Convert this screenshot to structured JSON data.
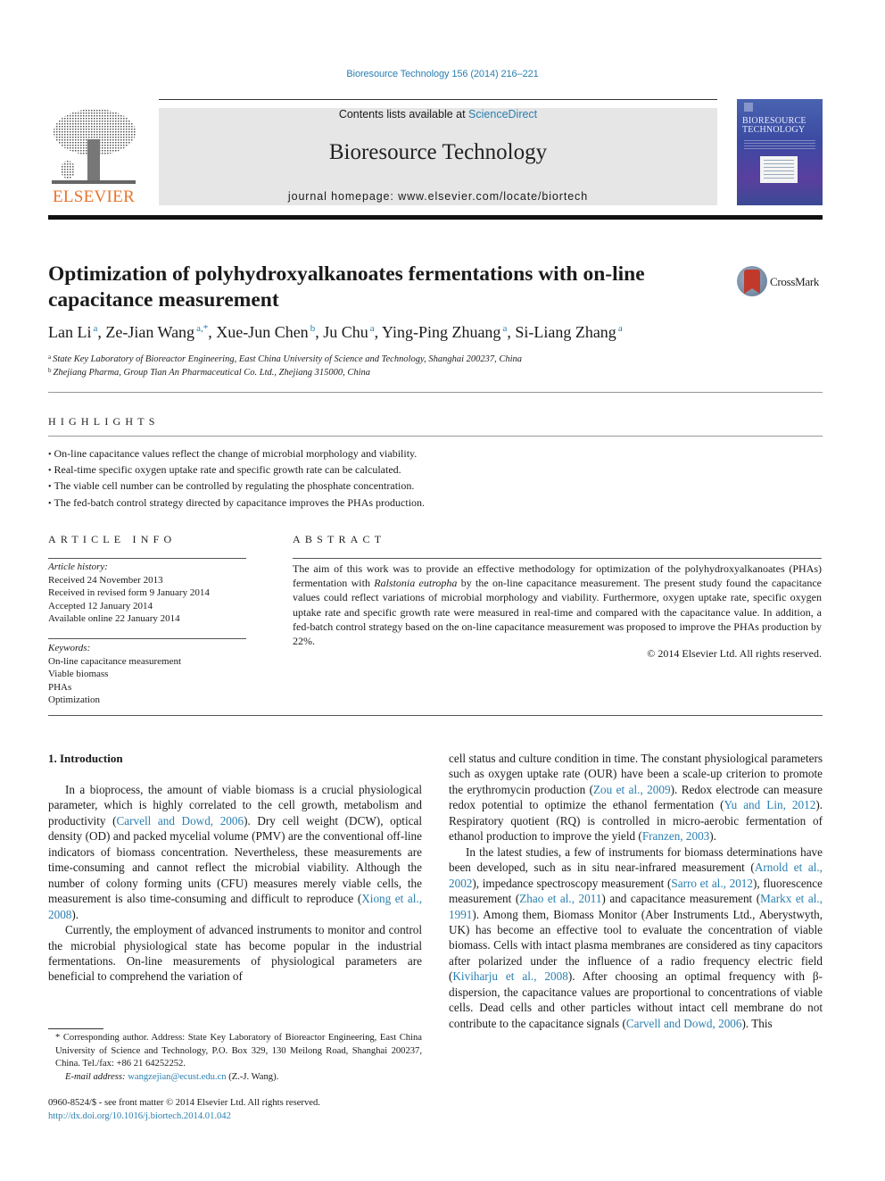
{
  "header": {
    "citation": "Bioresource Technology 156 (2014) 216–221",
    "contents_prefix": "Contents lists available at ",
    "contents_link": "ScienceDirect",
    "journal_name": "Bioresource Technology",
    "homepage": "journal homepage: www.elsevier.com/locate/biortech",
    "publisher_logo_text": "ELSEVIER",
    "cover_title_line1": "BIORESOURCE",
    "cover_title_line2": "TECHNOLOGY",
    "crossmark_label": "CrossMark"
  },
  "article": {
    "title": "Optimization of polyhydroxyalkanoates fermentations with on-line capacitance measurement",
    "authors": [
      {
        "name": "Lan Li",
        "aff": "a"
      },
      {
        "name": "Ze-Jian Wang",
        "aff": "a,*"
      },
      {
        "name": "Xue-Jun Chen",
        "aff": "b"
      },
      {
        "name": "Ju Chu",
        "aff": "a"
      },
      {
        "name": "Ying-Ping Zhuang",
        "aff": "a"
      },
      {
        "name": "Si-Liang Zhang",
        "aff": "a"
      }
    ],
    "affiliations": [
      {
        "key": "a",
        "text": "State Key Laboratory of Bioreactor Engineering, East China University of Science and Technology, Shanghai 200237, China"
      },
      {
        "key": "b",
        "text": "Zhejiang Pharma, Group Tian An Pharmaceutical Co. Ltd., Zhejiang 315000, China"
      }
    ]
  },
  "highlights": {
    "heading": "HIGHLIGHTS",
    "items": [
      "On-line capacitance values reflect the change of microbial morphology and viability.",
      "Real-time specific oxygen uptake rate and specific growth rate can be calculated.",
      "The viable cell number can be controlled by regulating the phosphate concentration.",
      "The fed-batch control strategy directed by capacitance improves the PHAs production."
    ]
  },
  "article_info": {
    "heading": "ARTICLE INFO",
    "history_label": "Article history:",
    "history": [
      "Received 24 November 2013",
      "Received in revised form 9 January 2014",
      "Accepted 12 January 2014",
      "Available online 22 January 2014"
    ],
    "keywords_label": "Keywords:",
    "keywords": [
      "On-line capacitance measurement",
      "Viable biomass",
      "PHAs",
      "Optimization"
    ]
  },
  "abstract": {
    "heading": "ABSTRACT",
    "part1": "The aim of this work was to provide an effective methodology for optimization of the polyhydroxyalkano­ates (PHAs) fermentation with ",
    "organism": "Ralstonia eutropha",
    "part2": " by the on-line capacitance measurement. The present study found the capacitance values could reflect variations of microbial morphology and viability. Fur­thermore, oxygen uptake rate, specific oxygen uptake rate and specific growth rate were measured in real-time and compared with the capacitance value. In addition, a fed-batch control strategy based on the on-line capacitance measurement was proposed to improve the PHAs production by 22%.",
    "copyright": "© 2014 Elsevier Ltd. All rights reserved."
  },
  "introduction": {
    "heading": "1. Introduction",
    "p1": [
      {
        "t": "In a bioprocess, the amount of viable biomass is a crucial phys­iological parameter, which is highly correlated to the cell growth, metabolism and productivity ("
      },
      {
        "link": "Carvell and Dowd, 2006"
      },
      {
        "t": "). Dry cell weight (DCW), optical density (OD) and packed mycelial volume (PMV) are the conventional off-line indicators of biomass concen­tration. Nevertheless, these measurements are time-consuming and cannot reflect the microbial viability. Although the number of colony forming units (CFU) measures merely viable cells, the measurement is also time-consuming and difficult to reproduce ("
      },
      {
        "link": "Xiong et al., 2008"
      },
      {
        "t": ")."
      }
    ],
    "p2": [
      {
        "t": "Currently, the employment of advanced instruments to monitor and control the microbial physiological state has become popular in the industrial fermentations. On-line measurements of physio­logical parameters are beneficial to comprehend the variation of "
      }
    ],
    "p2_cont": [
      {
        "t": "cell status and culture condition in time. The constant physiologi­cal parameters such as oxygen uptake rate (OUR) have been a scale-up criterion to promote the erythromycin production ("
      },
      {
        "link": "Zou et al., 2009"
      },
      {
        "t": "). Redox electrode can measure redox potential to opti­mize the ethanol fermentation ("
      },
      {
        "link": "Yu and Lin, 2012"
      },
      {
        "t": "). Respiratory quo­tient (RQ) is controlled in micro-aerobic fermentation of ethanol production to improve the yield ("
      },
      {
        "link": "Franzen, 2003"
      },
      {
        "t": ")."
      }
    ],
    "p3": [
      {
        "t": "In the latest studies, a few of instruments for biomass determi­nations have been developed, such as in situ near-infrared mea­surement ("
      },
      {
        "link": "Arnold et al., 2002"
      },
      {
        "t": "), impedance spectroscopy measurement ("
      },
      {
        "link": "Sarro et al., 2012"
      },
      {
        "t": "), fluorescence measurement ("
      },
      {
        "link": "Zhao et al., 2011"
      },
      {
        "t": ") and capacitance measurement ("
      },
      {
        "link": "Markx et al., 1991"
      },
      {
        "t": "). Among them, Biomass Monitor (Aber Instruments Ltd., Aber­ystwyth, UK) has become an effective tool to evaluate the concen­tration of viable biomass. Cells with intact plasma membranes are considered as tiny capacitors after polarized under the influence of a radio frequency electric field ("
      },
      {
        "link": "Kiviharju et al., 2008"
      },
      {
        "t": "). After choos­ing an optimal frequency with β-dispersion, the capacitance values are proportional to concentrations of viable cells. Dead cells and other particles without intact cell membrane do not contribute to the capacitance signals ("
      },
      {
        "link": "Carvell and Dowd, 2006"
      },
      {
        "t": "). This"
      }
    ]
  },
  "footnotes": {
    "corresponding": "* Corresponding author. Address: State Key Laboratory of Bioreactor Engineering, East China University of Science and Technology, P.O. Box 329, 130 Meilong Road, Shanghai 200237, China. Tel./fax: +86 21 64252252.",
    "email_label": "E-mail address: ",
    "email": "wangzejian@ecust.edu.cn",
    "email_suffix": " (Z.-J. Wang).",
    "front_matter": "0960-8524/$ - see front matter © 2014 Elsevier Ltd. All rights reserved.",
    "doi": "http://dx.doi.org/10.1016/j.biortech.2014.01.042"
  },
  "colors": {
    "link": "#2a7fb0",
    "elsevier_orange": "#e8742a",
    "banner_gray": "#e6e6e6"
  }
}
